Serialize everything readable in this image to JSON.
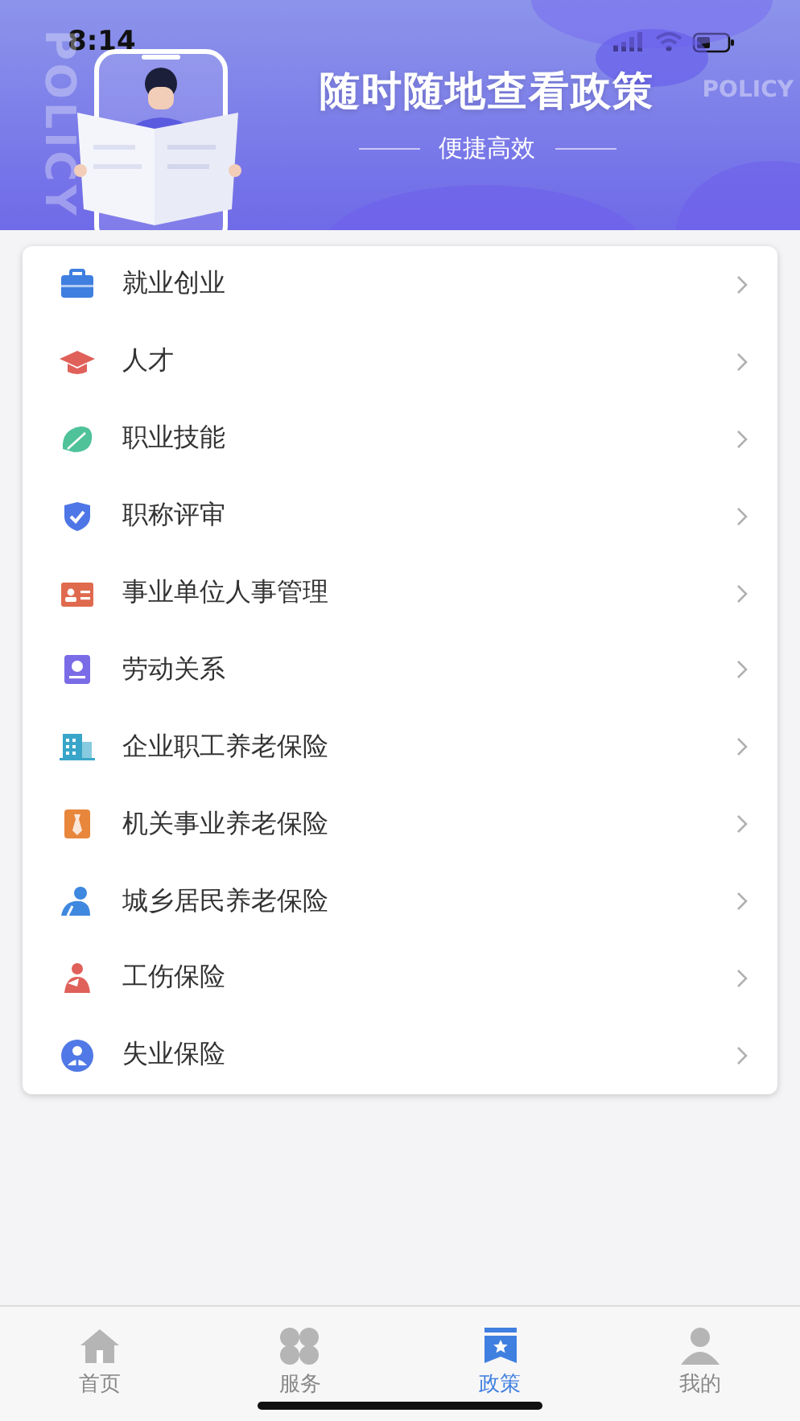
{
  "status_bar": {
    "time": "8:14"
  },
  "banner": {
    "title": "随时随地查看政策",
    "subtitle": "便捷高效",
    "background_text": [
      "POLICY",
      "POLICY"
    ]
  },
  "menu": [
    {
      "label": "就业创业",
      "color": "#3f7fe0"
    },
    {
      "label": "人才",
      "color": "#e0605a"
    },
    {
      "label": "职业技能",
      "color": "#4fc29a"
    },
    {
      "label": "职称评审",
      "color": "#4f76e6"
    },
    {
      "label": "事业单位人事管理",
      "color": "#e06a4e"
    },
    {
      "label": "劳动关系",
      "color": "#7a6be6"
    },
    {
      "label": "企业职工养老保险",
      "color": "#39a6c9"
    },
    {
      "label": "机关事业养老保险",
      "color": "#e8863c"
    },
    {
      "label": "城乡居民养老保险",
      "color": "#3f88e0"
    },
    {
      "label": "工伤保险",
      "color": "#e0605a"
    },
    {
      "label": "失业保险",
      "color": "#5078e6"
    }
  ],
  "tabs": [
    {
      "label": "首页",
      "selected": false
    },
    {
      "label": "服务",
      "selected": false
    },
    {
      "label": "政策",
      "selected": true
    },
    {
      "label": "我的",
      "selected": false
    }
  ]
}
